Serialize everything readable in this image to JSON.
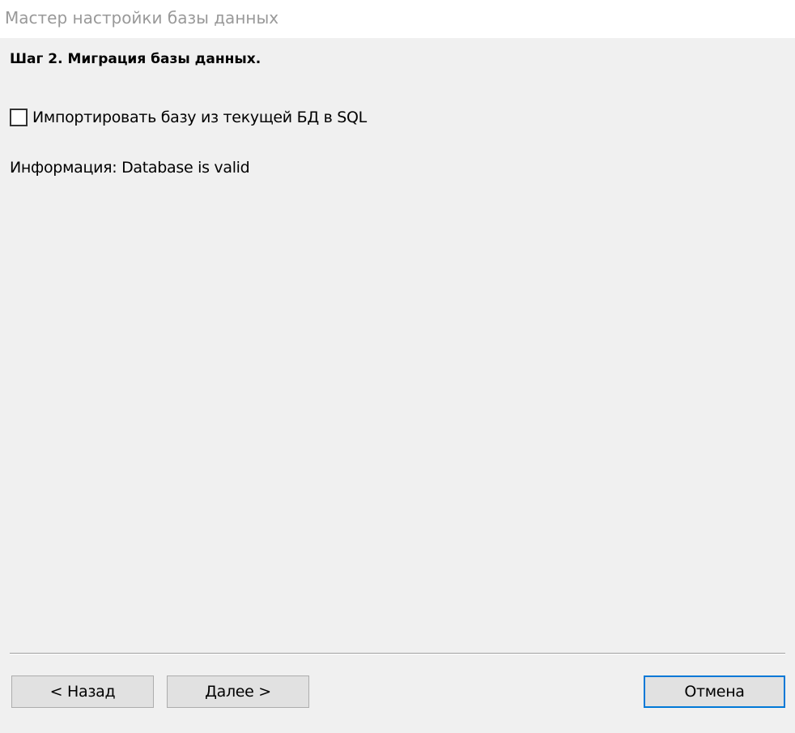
{
  "window": {
    "title": "Мастер настройки базы данных"
  },
  "step": {
    "heading": "Шаг 2. Миграция базы данных."
  },
  "import_option": {
    "label": "Импортировать базу из текущей БД в SQL",
    "checked": false
  },
  "info": {
    "text": "Информация: Database is valid"
  },
  "buttons": {
    "back_label": "< Назад",
    "next_label": "Далее >",
    "cancel_label": "Отмена"
  },
  "colors": {
    "background": "#f0f0f0",
    "titlebar": "#ffffff",
    "title_text": "#999999",
    "button_face": "#e1e1e1",
    "button_border": "#adadad",
    "focus_accent": "#0078d7"
  }
}
